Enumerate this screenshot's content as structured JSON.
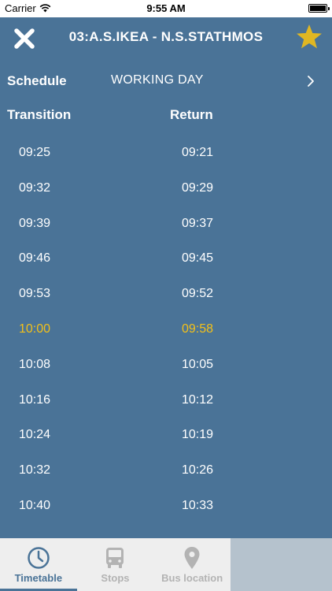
{
  "status_bar": {
    "carrier": "Carrier",
    "time": "9:55 AM"
  },
  "header": {
    "title": "03:A.S.IKEA - N.S.STATHMOS",
    "favorite_color": "#e0b723"
  },
  "schedule": {
    "label": "Schedule",
    "value": "WORKING DAY"
  },
  "columns": {
    "transition": "Transition",
    "return": "Return"
  },
  "times": [
    {
      "transition": "09:25",
      "return": "09:21"
    },
    {
      "transition": "09:32",
      "return": "09:29"
    },
    {
      "transition": "09:39",
      "return": "09:37"
    },
    {
      "transition": "09:46",
      "return": "09:45"
    },
    {
      "transition": "09:53",
      "return": "09:52"
    },
    {
      "transition": "10:00",
      "return": "09:58"
    },
    {
      "transition": "10:08",
      "return": "10:05"
    },
    {
      "transition": "10:16",
      "return": "10:12"
    },
    {
      "transition": "10:24",
      "return": "10:19"
    },
    {
      "transition": "10:32",
      "return": "10:26"
    },
    {
      "transition": "10:40",
      "return": "10:33"
    }
  ],
  "highlight_color": "#f3c019",
  "tabbar": {
    "tabs": [
      {
        "label": "Timetable",
        "icon": "clock-icon",
        "active": true
      },
      {
        "label": "Stops",
        "icon": "bus-icon",
        "active": false
      },
      {
        "label": "Bus location",
        "icon": "location-pin-icon",
        "active": false
      }
    ]
  }
}
